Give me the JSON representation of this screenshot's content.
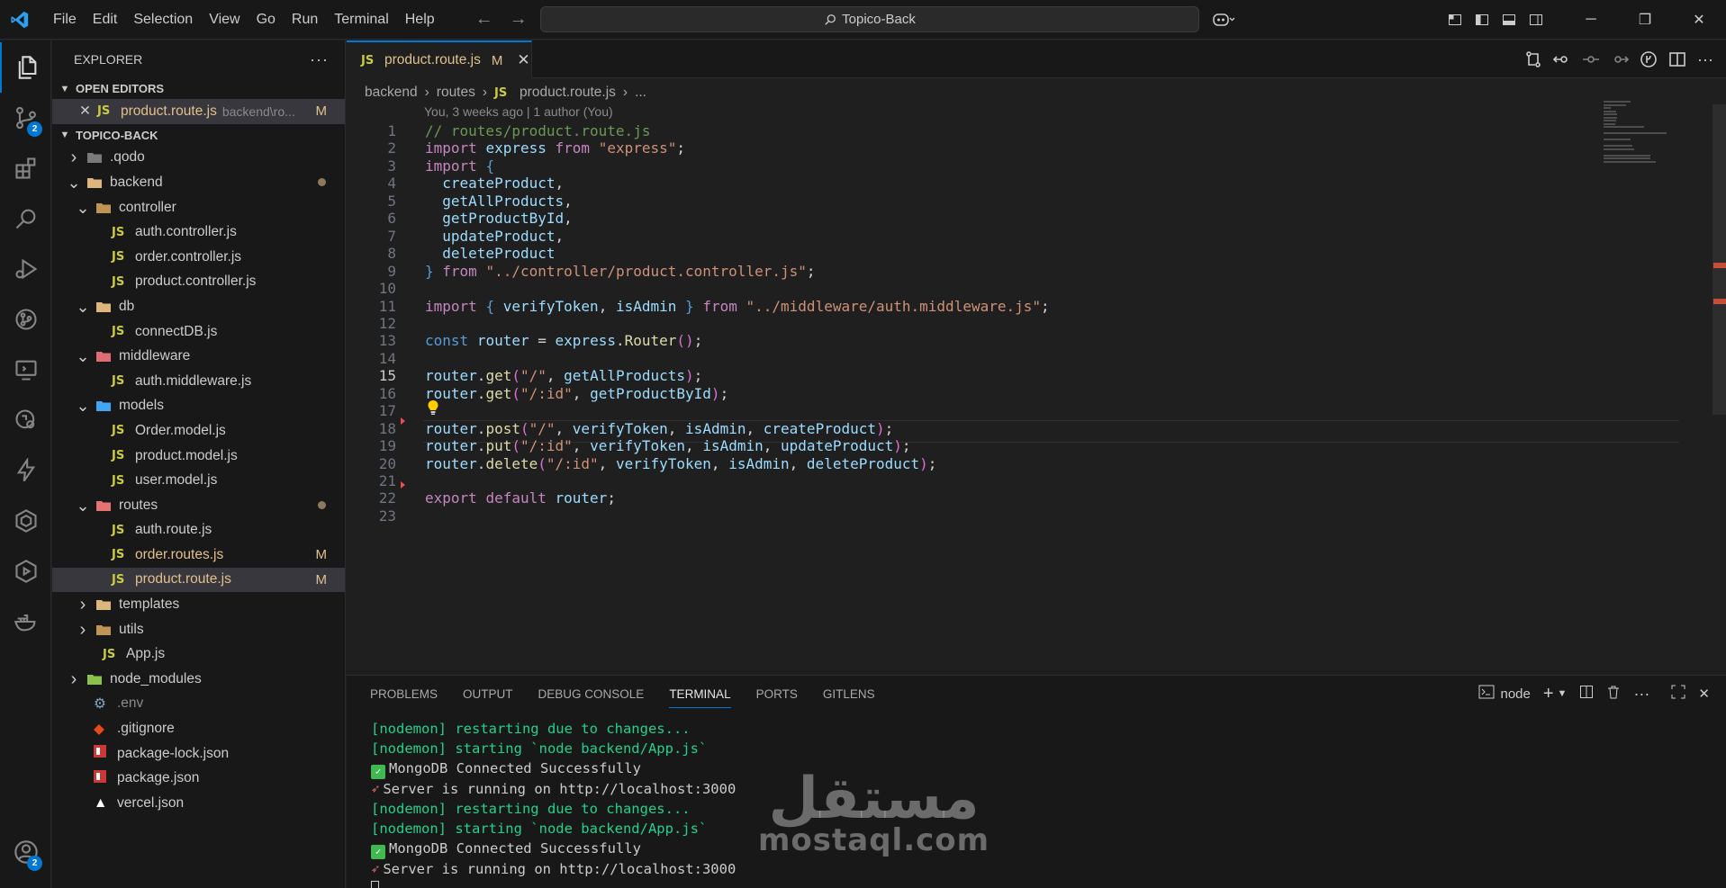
{
  "title_bar": {
    "menu": [
      "File",
      "Edit",
      "Selection",
      "View",
      "Go",
      "Run",
      "Terminal",
      "Help"
    ],
    "search_text": "Topico-Back"
  },
  "activity_bar": {
    "source_control_badge": "2",
    "accounts_badge": "2"
  },
  "explorer": {
    "header": "EXPLORER",
    "open_editors_label": "OPEN EDITORS",
    "open_editor": {
      "name": "product.route.js",
      "path": "backend\\ro...",
      "status": "M"
    },
    "project_label": "TOPICO-BACK",
    "tree": [
      {
        "name": ".qodo",
        "kind": "folder",
        "icon": "folder-icon",
        "chevron": "right"
      },
      {
        "name": "backend",
        "kind": "folder-open",
        "icon": "folder-open-icon",
        "chevron": "down",
        "modified": true
      },
      {
        "name": "controller",
        "kind": "folder-open",
        "icon": "controller-folder-icon",
        "chevron": "down"
      },
      {
        "name": "auth.controller.js",
        "kind": "js"
      },
      {
        "name": "order.controller.js",
        "kind": "js"
      },
      {
        "name": "product.controller.js",
        "kind": "js"
      },
      {
        "name": "db",
        "kind": "folder-open",
        "icon": "db-folder-icon",
        "chevron": "down"
      },
      {
        "name": "connectDB.js",
        "kind": "js"
      },
      {
        "name": "middleware",
        "kind": "folder-open",
        "icon": "middleware-folder-icon",
        "chevron": "down"
      },
      {
        "name": "auth.middleware.js",
        "kind": "js"
      },
      {
        "name": "models",
        "kind": "folder-open",
        "icon": "models-folder-icon",
        "chevron": "down"
      },
      {
        "name": "Order.model.js",
        "kind": "js"
      },
      {
        "name": "product.model.js",
        "kind": "js"
      },
      {
        "name": "user.model.js",
        "kind": "js"
      },
      {
        "name": "routes",
        "kind": "folder-open",
        "icon": "routes-folder-icon",
        "chevron": "down",
        "modified": true
      },
      {
        "name": "auth.route.js",
        "kind": "js"
      },
      {
        "name": "order.routes.js",
        "kind": "js",
        "status": "M"
      },
      {
        "name": "product.route.js",
        "kind": "js",
        "status": "M",
        "selected": true
      },
      {
        "name": "templates",
        "kind": "folder",
        "icon": "templates-folder-icon",
        "chevron": "right"
      },
      {
        "name": "utils",
        "kind": "folder",
        "icon": "utils-folder-icon",
        "chevron": "right"
      },
      {
        "name": "App.js",
        "kind": "js"
      },
      {
        "name": "node_modules",
        "kind": "folder",
        "icon": "node-modules-folder-icon",
        "chevron": "right"
      },
      {
        "name": ".env",
        "kind": "env"
      },
      {
        "name": ".gitignore",
        "kind": "git"
      },
      {
        "name": "package-lock.json",
        "kind": "npm"
      },
      {
        "name": "package.json",
        "kind": "npm"
      },
      {
        "name": "vercel.json",
        "kind": "vercel"
      }
    ]
  },
  "editor": {
    "tab": {
      "label": "product.route.js",
      "status": "M"
    },
    "breadcrumb": [
      "backend",
      "routes",
      "product.route.js",
      "..."
    ],
    "blame": "You, 3 weeks ago | 1 author (You)",
    "current_line": 15,
    "lines": [
      "// routes/product.route.js",
      "import express from \"express\";",
      "import {",
      "  createProduct,",
      "  getAllProducts,",
      "  getProductById,",
      "  updateProduct,",
      "  deleteProduct",
      "} from \"../controller/product.controller.js\";",
      "",
      "import { verifyToken, isAdmin } from \"../middleware/auth.middleware.js\";",
      "",
      "const router = express.Router();",
      "",
      "router.get(\"/\", getAllProducts);",
      "router.get(\"/:id\", getProductById);",
      "",
      "router.post(\"/\", verifyToken, isAdmin, createProduct);",
      "router.put(\"/:id\", verifyToken, isAdmin, updateProduct);",
      "router.delete(\"/:id\", verifyToken, isAdmin, deleteProduct);",
      "",
      "export default router;",
      ""
    ]
  },
  "panel": {
    "tabs": [
      "PROBLEMS",
      "OUTPUT",
      "DEBUG CONSOLE",
      "TERMINAL",
      "PORTS",
      "GITLENS"
    ],
    "active_tab": "TERMINAL",
    "shell_label": "node",
    "terminal_lines": [
      {
        "kind": "nodemon",
        "text": "[nodemon] restarting due to changes..."
      },
      {
        "kind": "nodemon",
        "text": "[nodemon] starting `node backend/App.js`"
      },
      {
        "kind": "check",
        "text": "MongoDB Connected Successfully"
      },
      {
        "kind": "rocket",
        "text": "Server is running on http://localhost:3000"
      },
      {
        "kind": "nodemon",
        "text": "[nodemon] restarting due to changes..."
      },
      {
        "kind": "nodemon",
        "text": "[nodemon] starting `node backend/App.js`"
      },
      {
        "kind": "check",
        "text": "MongoDB Connected Successfully"
      },
      {
        "kind": "rocket",
        "text": "Server is running on http://localhost:3000"
      }
    ]
  },
  "watermark": {
    "arabic": "مستقل",
    "latin": "mostaql.com"
  },
  "colors": {
    "accent": "#0078d4",
    "modified": "#e2c08d",
    "js": "#cbcb41",
    "terminal_green": "#23d18b"
  }
}
